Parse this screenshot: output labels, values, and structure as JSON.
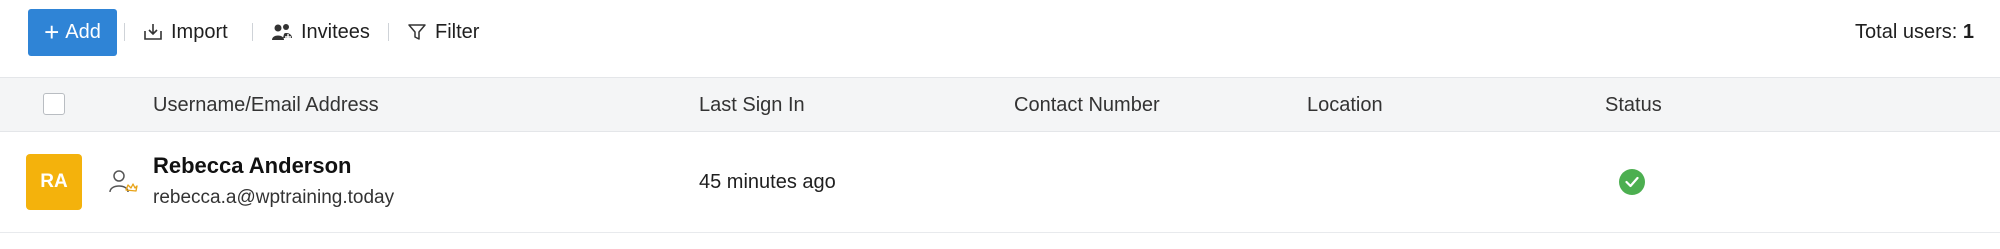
{
  "toolbar": {
    "add_label": "Add",
    "import_label": "Import",
    "invitees_label": "Invitees",
    "filter_label": "Filter",
    "total_prefix": "Total users: ",
    "total_count": "1"
  },
  "table": {
    "columns": [
      "Username/Email Address",
      "Last Sign In",
      "Contact Number",
      "Location",
      "Status"
    ],
    "rows": [
      {
        "initials": "RA",
        "name": "Rebecca Anderson",
        "email": "rebecca.a@wptraining.today",
        "last_sign_in": "45 minutes ago",
        "contact_number": "",
        "location": "",
        "status": "active",
        "role_icon": "admin-user-icon"
      }
    ]
  },
  "colors": {
    "accent": "#2f84d6",
    "avatar": "#f4b20c",
    "status_active": "#4caf50",
    "header_bg": "#f4f5f6"
  }
}
